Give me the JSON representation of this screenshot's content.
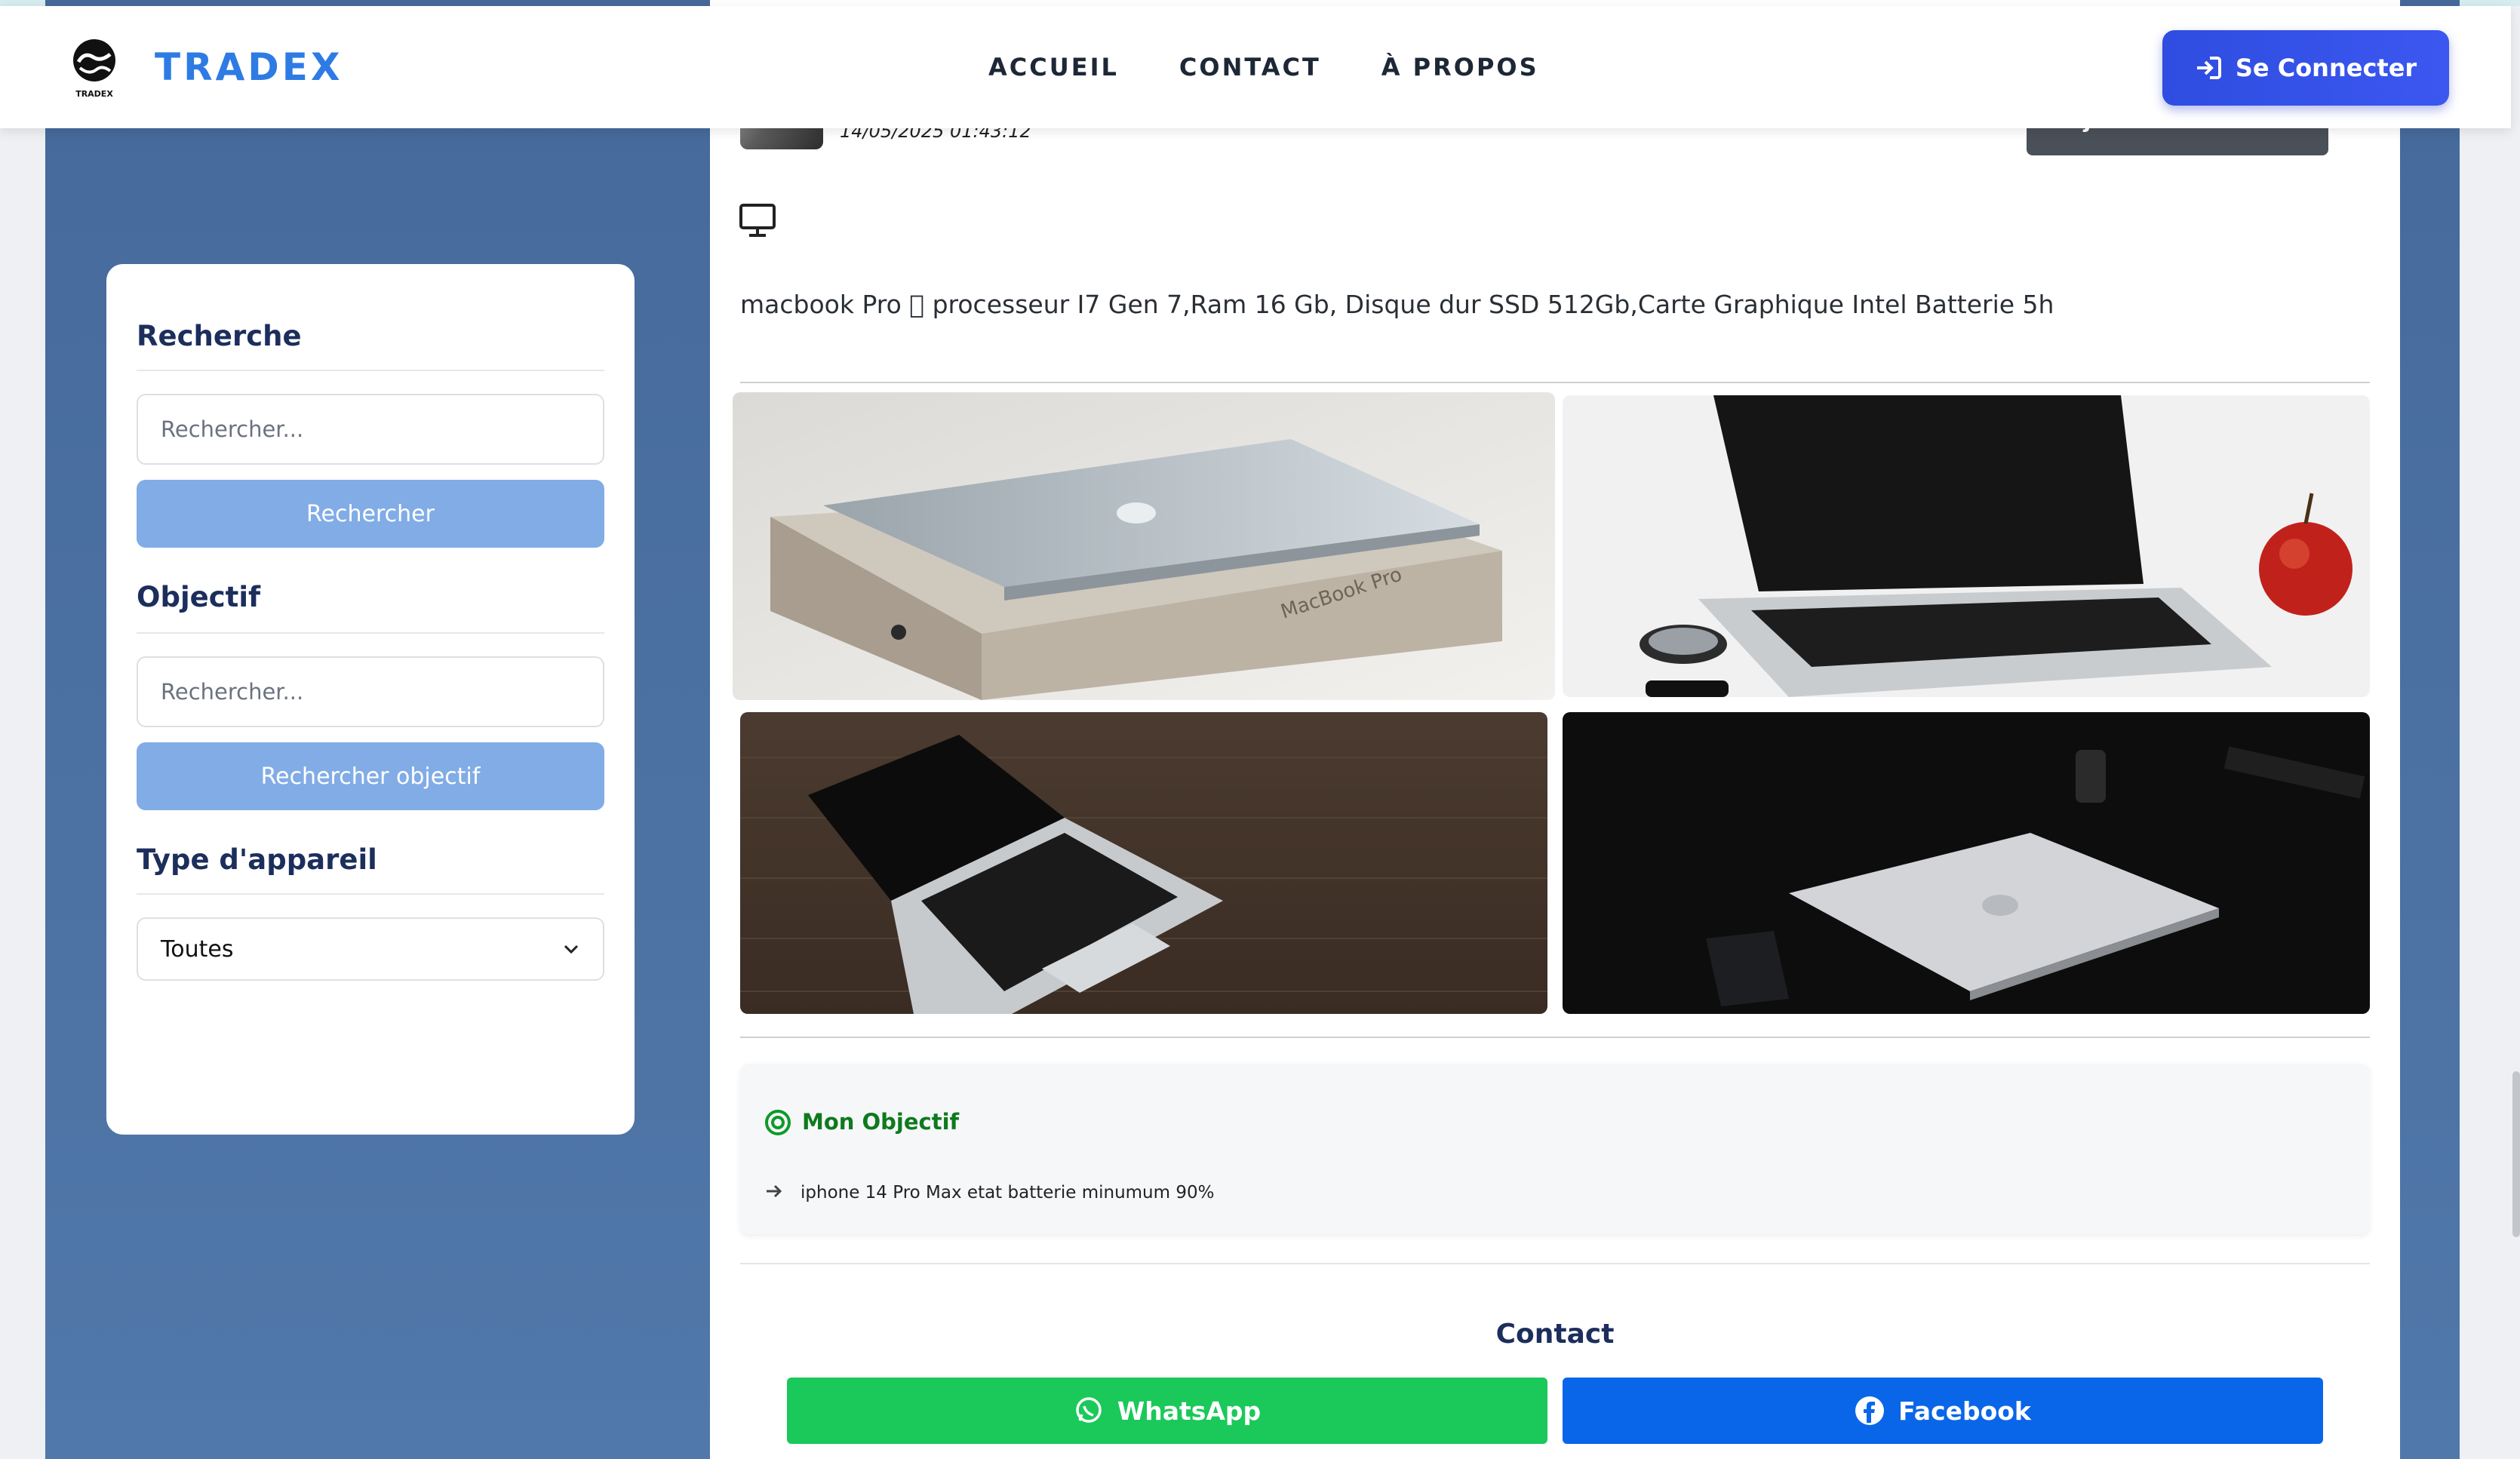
{
  "header": {
    "brand": "TRADEX",
    "logo_caption": "TRADEX",
    "nav": [
      "ACCUEIL",
      "CONTACT",
      "À PROPOS"
    ],
    "login_label": "Se Connecter"
  },
  "sidebar": {
    "search_title": "Recherche",
    "search_placeholder": "Rechercher...",
    "search_button": "Rechercher",
    "objective_title": "Objectif",
    "objective_placeholder": "Rechercher...",
    "objective_button": "Rechercher objectif",
    "device_title": "Type d'appareil",
    "device_selected": "Toutes"
  },
  "post": {
    "date": "14/05/2025 01:43:12",
    "favorite_label": "Ajouter au favoris",
    "description": "macbook Pro  processeur I7 Gen 7,Ram 16 Gb, Disque dur SSD 512Gb,Carte Graphique Intel Batterie 5h",
    "photos": [
      "macbook-pro-box-photo",
      "macbook-with-apple-photo",
      "macbook-on-wood-desk-photo",
      "macbook-closed-dark-photo"
    ],
    "photo_text": "MacBook Pro"
  },
  "objective": {
    "title": "Mon Objectif",
    "item": "iphone 14 Pro Max etat batterie minumum 90%"
  },
  "contact": {
    "title": "Contact",
    "whatsapp": "WhatsApp",
    "facebook": "Facebook",
    "whatsapp_color": "#1ac95a",
    "facebook_color": "#0a66e8"
  }
}
